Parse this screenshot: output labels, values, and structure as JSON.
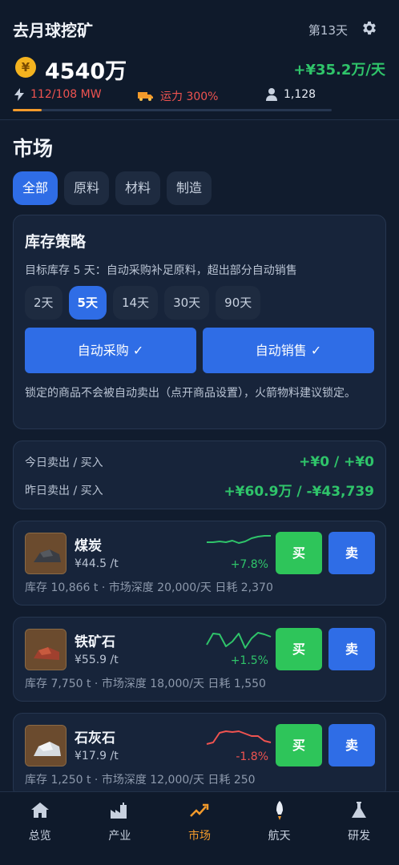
{
  "app": {
    "title": "去月球挖矿",
    "day": "第13天"
  },
  "resources": {
    "money": "4540万",
    "coin_symbol": "¥",
    "income": "+¥35.2万/天",
    "power": "112/108 MW",
    "transport": "运力 300%",
    "population": "1,128",
    "progress": 0.09
  },
  "market": {
    "title": "市场",
    "tabs": [
      "全部",
      "原料",
      "材料",
      "制造"
    ],
    "active_tab": "全部"
  },
  "strategy": {
    "title": "库存策略",
    "description": "目标库存 5 天：自动采购补足原料，超出部分自动销售",
    "day_options": [
      "2天",
      "5天",
      "14天",
      "30天",
      "90天"
    ],
    "selected_day": "5天",
    "auto_buy_label": "自动采购 ✓",
    "auto_sell_label": "自动销售 ✓",
    "note": "锁定的商品不会被自动卖出（点开商品设置），火箭物料建议锁定。"
  },
  "trade_summary": {
    "today_label": "今日卖出 / 买入",
    "today_value": "+¥0 / +¥0",
    "yesterday_label": "昨日卖出 / 买入",
    "yesterday_value": "+¥60.9万 / -¥43,739"
  },
  "items": [
    {
      "name": "煤炭",
      "price": "¥44.5 /t",
      "change": "+7.8%",
      "trend": "up",
      "spark": [
        10,
        10,
        9,
        10,
        8,
        11,
        9,
        5,
        3,
        2,
        2
      ],
      "meta": "库存 10,866 t · 市场深度 20,000/天 日耗 2,370",
      "buy_label": "买",
      "sell_label": "卖",
      "icon": "coal-icon"
    },
    {
      "name": "铁矿石",
      "price": "¥55.9 /t",
      "change": "+1.5%",
      "trend": "up",
      "spark": [
        18,
        4,
        5,
        20,
        14,
        4,
        22,
        10,
        3,
        5,
        8
      ],
      "meta": "库存 7,750 t · 市场深度 18,000/天 日耗 1,550",
      "buy_label": "买",
      "sell_label": "卖",
      "icon": "iron-ore-icon"
    },
    {
      "name": "石灰石",
      "price": "¥17.9 /t",
      "change": "-1.8%",
      "trend": "down",
      "spark": [
        22,
        20,
        8,
        6,
        7,
        6,
        9,
        12,
        12,
        18,
        20
      ],
      "meta": "库存 1,250 t · 市场深度 12,000/天 日耗 250",
      "buy_label": "买",
      "sell_label": "卖",
      "icon": "limestone-icon"
    }
  ],
  "colors": {
    "up": "#2fc46a",
    "down": "#ef5350",
    "accent": "#2f6de6",
    "orange": "#f39a2b"
  },
  "nav": [
    {
      "label": "总览",
      "icon": "home-icon"
    },
    {
      "label": "产业",
      "icon": "factory-icon"
    },
    {
      "label": "市场",
      "icon": "trend-icon",
      "active": true
    },
    {
      "label": "航天",
      "icon": "rocket-icon"
    },
    {
      "label": "研发",
      "icon": "flask-icon"
    }
  ]
}
